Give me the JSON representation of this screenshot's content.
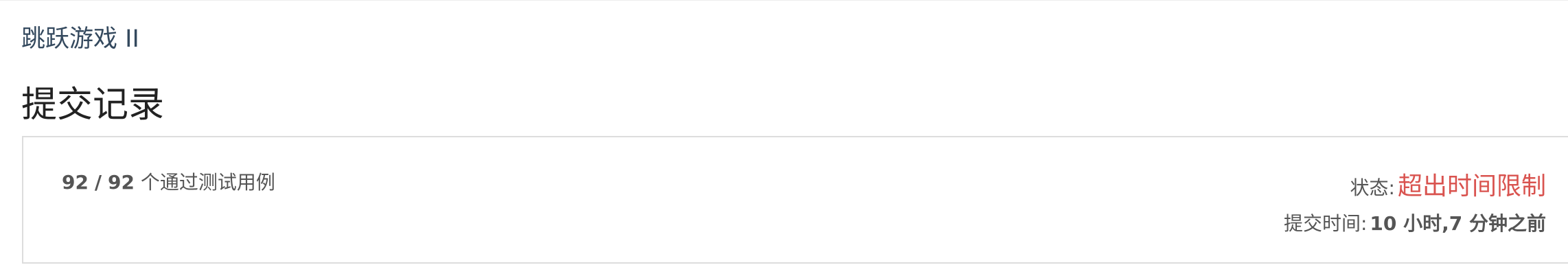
{
  "problem": {
    "title": "跳跃游戏 II"
  },
  "page": {
    "title": "提交记录"
  },
  "submission": {
    "passed": "92",
    "separator": "/",
    "total": "92",
    "passed_suffix": "个通过测试用例",
    "status_label": "状态:",
    "status_value": "超出时间限制",
    "status_color": "#d9534f",
    "time_label": "提交时间:",
    "time_value": "10 小时,7 分钟之前"
  }
}
